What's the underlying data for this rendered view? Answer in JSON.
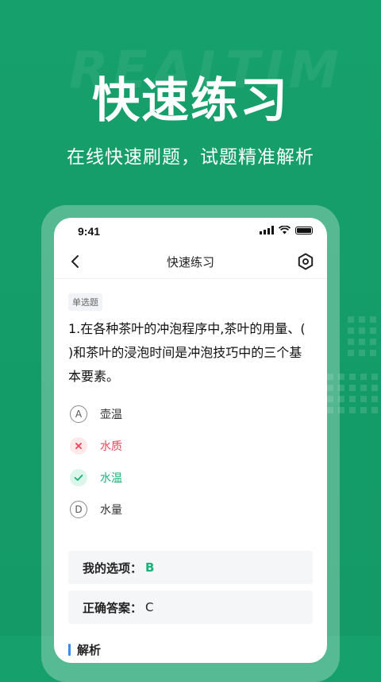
{
  "promo": {
    "bg_word": "REALTIM",
    "headline": "快速练习",
    "subline": "在线快速刷题，试题精准解析"
  },
  "status_bar": {
    "time": "9:41",
    "icons": [
      "signal-icon",
      "wifi-icon",
      "battery-icon"
    ]
  },
  "nav": {
    "title": "快速练习",
    "back_icon": "chevron-left-icon",
    "settings_icon": "hexagon-settings-icon"
  },
  "question": {
    "type_tag": "单选题",
    "text": "1.在各种茶叶的冲泡程序中,茶叶的用量、(  )和茶叶的浸泡时间是冲泡技巧中的三个基本要素。",
    "options": [
      {
        "key": "A",
        "text": "壶温",
        "state": "normal"
      },
      {
        "key": "B",
        "text": "水质",
        "state": "wrong",
        "icon": "cross-icon"
      },
      {
        "key": "C",
        "text": "水温",
        "state": "correct",
        "icon": "check-icon"
      },
      {
        "key": "D",
        "text": "水量",
        "state": "normal"
      }
    ]
  },
  "result": {
    "my_choice_label": "我的选项：",
    "my_choice_value": "B",
    "correct_label": "正确答案：",
    "correct_value": "C"
  },
  "analysis": {
    "heading": "解析"
  },
  "colors": {
    "brand_green": "#16a06b",
    "correct": "#19b27b",
    "wrong": "#e9465a",
    "accent_blue": "#3c8cf0"
  }
}
